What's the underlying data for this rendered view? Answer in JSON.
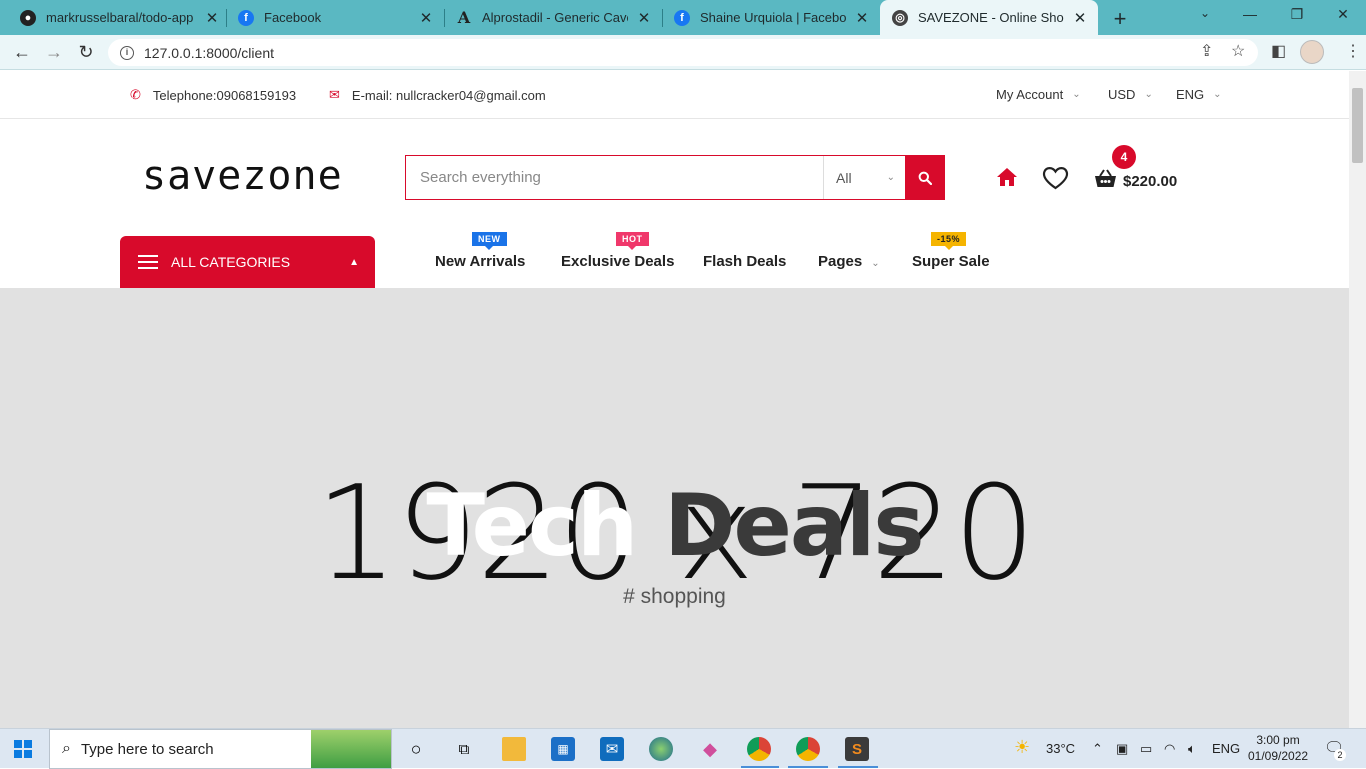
{
  "browser": {
    "tabs": [
      {
        "title": "markrusselbaral/todo-app",
        "icon": "github-icon"
      },
      {
        "title": "Facebook",
        "icon": "facebook-icon"
      },
      {
        "title": "Alprostadil - Generic Caverje",
        "icon": "a-letter-icon"
      },
      {
        "title": "Shaine Urquiola | Facebook",
        "icon": "facebook-icon"
      },
      {
        "title": "SAVEZONE - Online Shopping",
        "icon": "globe-icon",
        "active": true
      }
    ],
    "url": "127.0.0.1:8000/client"
  },
  "topbar": {
    "telephone": "Telephone:09068159193",
    "email": "E-mail: nullcracker04@gmail.com",
    "account": "My Account",
    "currency": "USD",
    "language": "ENG"
  },
  "header": {
    "logo": "savezone",
    "search_placeholder": "Search everything",
    "category": "All",
    "cart_count": "4",
    "cart_total": "$220.00"
  },
  "nav": {
    "all_categories": "ALL CATEGORIES",
    "items": [
      {
        "label": "New Arrivals",
        "badge": "NEW",
        "badge_color": "#1a73e8"
      },
      {
        "label": "Exclusive Deals",
        "badge": "HOT",
        "badge_color": "#f0386b"
      },
      {
        "label": "Flash Deals"
      },
      {
        "label": "Pages"
      },
      {
        "label": "Super Sale",
        "badge": "-15%",
        "badge_color": "#f5b400"
      }
    ]
  },
  "hero": {
    "placeholder_text": "1920 x 720",
    "title_part1": "Tech",
    "title_part2": "Deals",
    "subtitle": "# shopping"
  },
  "taskbar": {
    "search_placeholder": "Type here to search",
    "temperature": "33°C",
    "language": "ENG",
    "time": "3:00 pm",
    "date": "01/09/2022",
    "notification_count": "2"
  },
  "colors": {
    "brand": "#d80a2b",
    "tabstrip": "#5ab8c2"
  }
}
